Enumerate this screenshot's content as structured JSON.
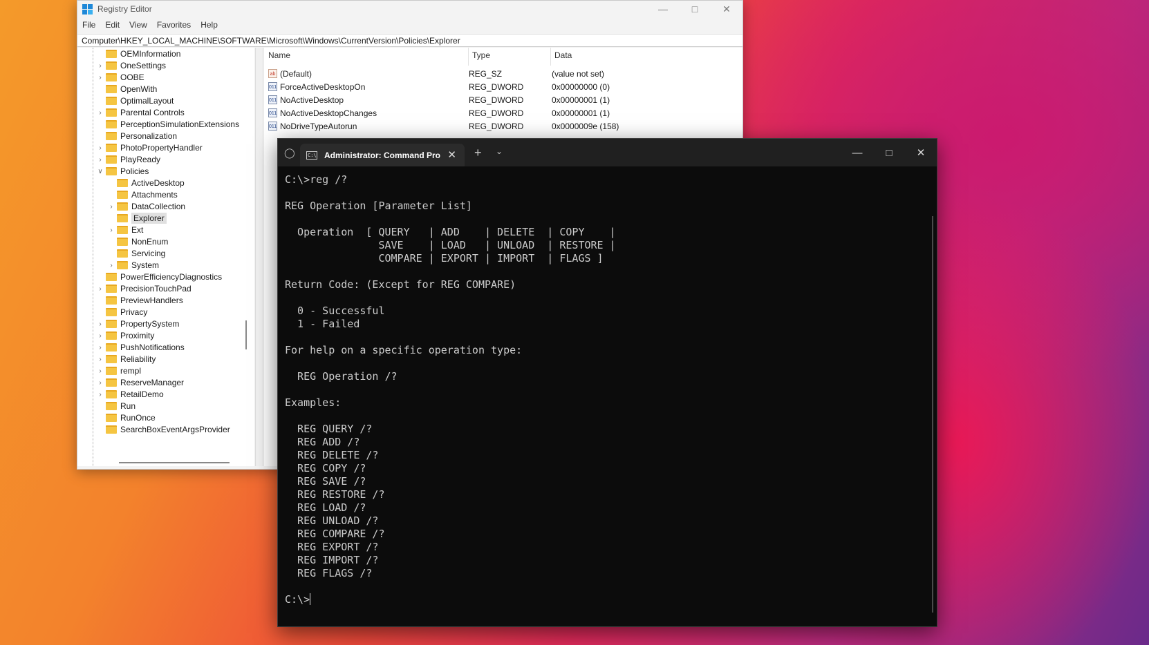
{
  "regedit": {
    "title": "Registry Editor",
    "menu": [
      "File",
      "Edit",
      "View",
      "Favorites",
      "Help"
    ],
    "address": "Computer\\HKEY_LOCAL_MACHINE\\SOFTWARE\\Microsoft\\Windows\\CurrentVersion\\Policies\\Explorer",
    "tree": [
      {
        "label": "OEMInformation",
        "level": 1,
        "expandable": false,
        "expanded": false,
        "selected": false
      },
      {
        "label": "OneSettings",
        "level": 1,
        "expandable": true,
        "expanded": false,
        "selected": false
      },
      {
        "label": "OOBE",
        "level": 1,
        "expandable": true,
        "expanded": false,
        "selected": false
      },
      {
        "label": "OpenWith",
        "level": 1,
        "expandable": false,
        "expanded": false,
        "selected": false
      },
      {
        "label": "OptimalLayout",
        "level": 1,
        "expandable": false,
        "expanded": false,
        "selected": false
      },
      {
        "label": "Parental Controls",
        "level": 1,
        "expandable": true,
        "expanded": false,
        "selected": false
      },
      {
        "label": "PerceptionSimulationExtensions",
        "level": 1,
        "expandable": false,
        "expanded": false,
        "selected": false
      },
      {
        "label": "Personalization",
        "level": 1,
        "expandable": false,
        "expanded": false,
        "selected": false
      },
      {
        "label": "PhotoPropertyHandler",
        "level": 1,
        "expandable": true,
        "expanded": false,
        "selected": false
      },
      {
        "label": "PlayReady",
        "level": 1,
        "expandable": true,
        "expanded": false,
        "selected": false
      },
      {
        "label": "Policies",
        "level": 1,
        "expandable": true,
        "expanded": true,
        "selected": false
      },
      {
        "label": "ActiveDesktop",
        "level": 2,
        "expandable": false,
        "expanded": false,
        "selected": false
      },
      {
        "label": "Attachments",
        "level": 2,
        "expandable": false,
        "expanded": false,
        "selected": false
      },
      {
        "label": "DataCollection",
        "level": 2,
        "expandable": true,
        "expanded": false,
        "selected": false
      },
      {
        "label": "Explorer",
        "level": 2,
        "expandable": false,
        "expanded": false,
        "selected": true
      },
      {
        "label": "Ext",
        "level": 2,
        "expandable": true,
        "expanded": false,
        "selected": false
      },
      {
        "label": "NonEnum",
        "level": 2,
        "expandable": false,
        "expanded": false,
        "selected": false
      },
      {
        "label": "Servicing",
        "level": 2,
        "expandable": false,
        "expanded": false,
        "selected": false
      },
      {
        "label": "System",
        "level": 2,
        "expandable": true,
        "expanded": false,
        "selected": false
      },
      {
        "label": "PowerEfficiencyDiagnostics",
        "level": 1,
        "expandable": false,
        "expanded": false,
        "selected": false
      },
      {
        "label": "PrecisionTouchPad",
        "level": 1,
        "expandable": true,
        "expanded": false,
        "selected": false
      },
      {
        "label": "PreviewHandlers",
        "level": 1,
        "expandable": false,
        "expanded": false,
        "selected": false
      },
      {
        "label": "Privacy",
        "level": 1,
        "expandable": false,
        "expanded": false,
        "selected": false
      },
      {
        "label": "PropertySystem",
        "level": 1,
        "expandable": true,
        "expanded": false,
        "selected": false
      },
      {
        "label": "Proximity",
        "level": 1,
        "expandable": true,
        "expanded": false,
        "selected": false
      },
      {
        "label": "PushNotifications",
        "level": 1,
        "expandable": true,
        "expanded": false,
        "selected": false
      },
      {
        "label": "Reliability",
        "level": 1,
        "expandable": true,
        "expanded": false,
        "selected": false
      },
      {
        "label": "rempl",
        "level": 1,
        "expandable": true,
        "expanded": false,
        "selected": false
      },
      {
        "label": "ReserveManager",
        "level": 1,
        "expandable": true,
        "expanded": false,
        "selected": false
      },
      {
        "label": "RetailDemo",
        "level": 1,
        "expandable": true,
        "expanded": false,
        "selected": false
      },
      {
        "label": "Run",
        "level": 1,
        "expandable": false,
        "expanded": false,
        "selected": false
      },
      {
        "label": "RunOnce",
        "level": 1,
        "expandable": false,
        "expanded": false,
        "selected": false
      },
      {
        "label": "SearchBoxEventArgsProvider",
        "level": 1,
        "expandable": false,
        "expanded": false,
        "selected": false
      }
    ],
    "columns": {
      "name": "Name",
      "type": "Type",
      "data": "Data"
    },
    "values": [
      {
        "icon": "string-value-icon",
        "name": "(Default)",
        "type": "REG_SZ",
        "data": "(value not set)"
      },
      {
        "icon": "binary-value-icon",
        "name": "ForceActiveDesktopOn",
        "type": "REG_DWORD",
        "data": "0x00000000 (0)"
      },
      {
        "icon": "binary-value-icon",
        "name": "NoActiveDesktop",
        "type": "REG_DWORD",
        "data": "0x00000001 (1)"
      },
      {
        "icon": "binary-value-icon",
        "name": "NoActiveDesktopChanges",
        "type": "REG_DWORD",
        "data": "0x00000001 (1)"
      },
      {
        "icon": "binary-value-icon",
        "name": "NoDriveTypeAutorun",
        "type": "REG_DWORD",
        "data": "0x0000009e (158)"
      }
    ]
  },
  "terminal": {
    "tab_title": "Administrator: Command Pro",
    "lines": [
      "C:\\>reg /?",
      "",
      "REG Operation [Parameter List]",
      "",
      "  Operation  [ QUERY   | ADD    | DELETE  | COPY    |",
      "               SAVE    | LOAD   | UNLOAD  | RESTORE |",
      "               COMPARE | EXPORT | IMPORT  | FLAGS ]",
      "",
      "Return Code: (Except for REG COMPARE)",
      "",
      "  0 - Successful",
      "  1 - Failed",
      "",
      "For help on a specific operation type:",
      "",
      "  REG Operation /?",
      "",
      "Examples:",
      "",
      "  REG QUERY /?",
      "  REG ADD /?",
      "  REG DELETE /?",
      "  REG COPY /?",
      "  REG SAVE /?",
      "  REG RESTORE /?",
      "  REG LOAD /?",
      "  REG UNLOAD /?",
      "  REG COMPARE /?",
      "  REG EXPORT /?",
      "  REG IMPORT /?",
      "  REG FLAGS /?",
      ""
    ],
    "prompt": "C:\\>"
  }
}
